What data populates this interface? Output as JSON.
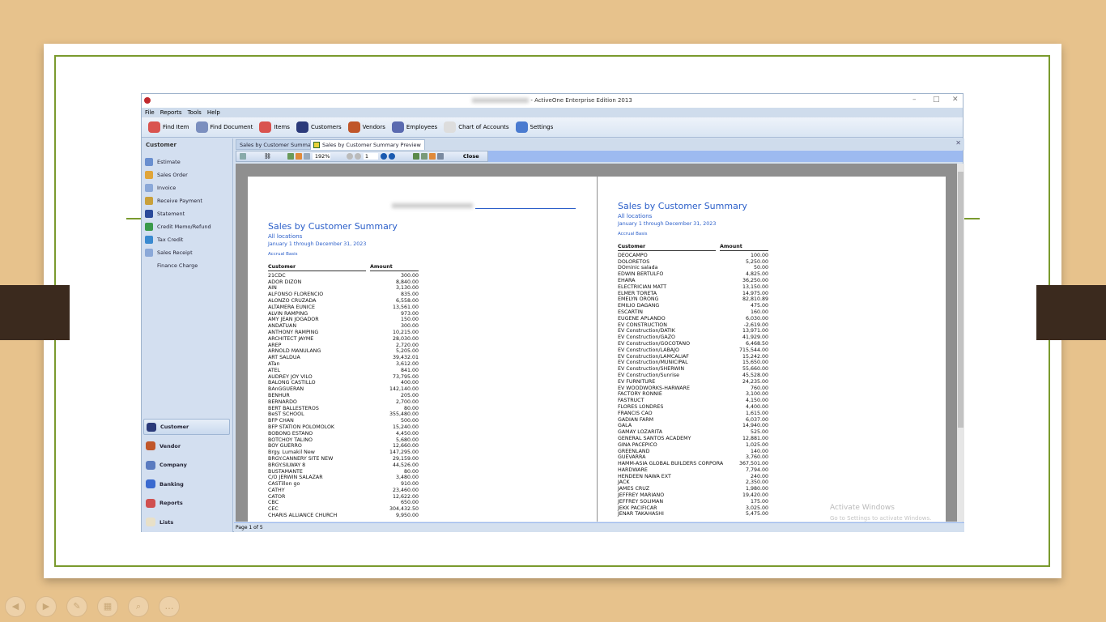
{
  "window": {
    "title": "- ActiveOne Enterprise Edition 2013"
  },
  "menu": [
    "File",
    "Reports",
    "Tools",
    "Help"
  ],
  "toolbar": [
    {
      "label": "Find Item",
      "icon": "find-item-icon",
      "color": "#d9534f"
    },
    {
      "label": "Find Document",
      "icon": "find-document-icon",
      "color": "#7b8fbf"
    },
    {
      "label": "Items",
      "icon": "items-icon",
      "color": "#d9534f"
    },
    {
      "label": "Customers",
      "icon": "customers-icon",
      "color": "#2b3a7a"
    },
    {
      "label": "Vendors",
      "icon": "vendors-icon",
      "color": "#c0562a"
    },
    {
      "label": "Employees",
      "icon": "employees-icon",
      "color": "#5a6ab0"
    },
    {
      "label": "Chart of Accounts",
      "icon": "chart-of-accounts-icon",
      "color": "#dddddd"
    },
    {
      "label": "Settings",
      "icon": "settings-icon",
      "color": "#4a7bd0"
    }
  ],
  "sidebar": {
    "header": "Customer",
    "items": [
      {
        "label": "Estimate",
        "icon": "estimate-icon",
        "color": "#6a8fcf"
      },
      {
        "label": "Sales Order",
        "icon": "sales-order-icon",
        "color": "#e0a53a"
      },
      {
        "label": "Invoice",
        "icon": "invoice-icon",
        "color": "#8aa8d8"
      },
      {
        "label": "Receive Payment",
        "icon": "receive-payment-icon",
        "color": "#c9a03a"
      },
      {
        "label": "Statement",
        "icon": "statement-icon",
        "color": "#2a4a9a"
      },
      {
        "label": "Credit Memo/Refund",
        "icon": "credit-memo-icon",
        "color": "#3a9a4a"
      },
      {
        "label": "Tax Credit",
        "icon": "tax-credit-icon",
        "color": "#3a8ad0"
      },
      {
        "label": "Sales Receipt",
        "icon": "sales-receipt-icon",
        "color": "#8aa8d8"
      },
      {
        "label": "Finance Charge",
        "icon": "",
        "color": ""
      }
    ],
    "nav": [
      {
        "label": "Customer",
        "icon": "customer-icon",
        "color": "#2b3a7a",
        "selected": true
      },
      {
        "label": "Vendor",
        "icon": "vendor-icon",
        "color": "#c0562a"
      },
      {
        "label": "Company",
        "icon": "company-icon",
        "color": "#5a7bc0"
      },
      {
        "label": "Banking",
        "icon": "banking-icon",
        "color": "#3a6ad0"
      },
      {
        "label": "Reports",
        "icon": "reports-icon",
        "color": "#d05050"
      },
      {
        "label": "Lists",
        "icon": "lists-icon",
        "color": "#e8e0c8"
      }
    ]
  },
  "tabs": [
    {
      "label": "Sales by Customer Summary",
      "active": false
    },
    {
      "label": "Sales by Customer Summary Preview",
      "active": true
    }
  ],
  "preview_toolbar": {
    "zoom": "192%",
    "page": "1",
    "close": "Close"
  },
  "status": "Page 1 of 5",
  "report": {
    "title": "Sales by Customer Summary",
    "locations": "All locations",
    "period": "January 1 through December 31, 2023",
    "basis": "Accrual Basis",
    "col_customer": "Customer",
    "col_amount": "Amount"
  },
  "left_page_rows": [
    [
      "21CDC",
      "300.00"
    ],
    [
      "ADOR DIZON",
      "8,840.00"
    ],
    [
      "AIN",
      "3,130.00"
    ],
    [
      "ALFONSO FLORENCIO",
      "835.00"
    ],
    [
      "ALONZO CRUZADA",
      "6,558.00"
    ],
    [
      "ALTAMERA EUNICE",
      "13,561.00"
    ],
    [
      "ALVIN RAMPING",
      "973.00"
    ],
    [
      "AMY JEAN JOGADOR",
      "150.00"
    ],
    [
      "ANDATUAN",
      "300.00"
    ],
    [
      "ANTHONY RAMPING",
      "10,215.00"
    ],
    [
      "ARCHITECT JAYME",
      "28,030.00"
    ],
    [
      "AREP",
      "2,720.00"
    ],
    [
      "ARNOLD MANULANG",
      "5,205.00"
    ],
    [
      "ART SALDUA",
      "39,432.01"
    ],
    [
      "ATan",
      "3,612.00"
    ],
    [
      "ATEL",
      "841.00"
    ],
    [
      "AUDREY JOY VILO",
      "73,795.00"
    ],
    [
      "BALONG CASTILLO",
      "400.00"
    ],
    [
      "BAnGGUERAN",
      "142,140.00"
    ],
    [
      "BENHUR",
      "205.00"
    ],
    [
      "BERNARDO",
      "2,700.00"
    ],
    [
      "BERT BALLESTEROS",
      "80.00"
    ],
    [
      "BeST SCHOOL",
      "355,480.00"
    ],
    [
      "BFP CHAN",
      "500.00"
    ],
    [
      "BFP STATION POLOMOLOK",
      "15,240.00"
    ],
    [
      "BOBONG ESTANO",
      "4,450.00"
    ],
    [
      "BOTCHOY TALINO",
      "5,680.00"
    ],
    [
      "BOY GUERRO",
      "12,660.00"
    ],
    [
      "Brgy. Lumakil New",
      "147,295.00"
    ],
    [
      "BRGY.CANNERY SITE NEW",
      "29,159.00"
    ],
    [
      "BRGY.SILWAY 8",
      "44,526.00"
    ],
    [
      "BUSTAMANTE",
      "80.00"
    ],
    [
      "C/O JERWIN SALAZAR",
      "3,480.00"
    ],
    [
      "CASTillon go",
      "910.00"
    ],
    [
      "CATHY",
      "23,460.00"
    ],
    [
      "CATOR",
      "12,622.00"
    ],
    [
      "CBC",
      "650.00"
    ],
    [
      "CEC",
      "304,432.50"
    ],
    [
      "CHARIS ALLIANCE CHURCH",
      "9,950.00"
    ]
  ],
  "right_page_rows": [
    [
      "DEOCAMPO",
      "100.00"
    ],
    [
      "DOLORETOS",
      "5,250.00"
    ],
    [
      "DOminic salada",
      "50.00"
    ],
    [
      "EDWIN BERTULFO",
      "4,825.00"
    ],
    [
      "EHARA",
      "36,250.00"
    ],
    [
      "ELECTRICIAN MATT",
      "13,150.00"
    ],
    [
      "ELMER TORETA",
      "14,975.00"
    ],
    [
      "EMELYN ORONG",
      "82,810.89"
    ],
    [
      "EMILIO DAGANG",
      "475.00"
    ],
    [
      "ESCARTIN",
      "160.00"
    ],
    [
      "EUGENE APLANDO",
      "6,030.00"
    ],
    [
      "EV CONSTRUCTION",
      "-2,619.00"
    ],
    [
      "EV Construction/DATIK",
      "13,971.00"
    ],
    [
      "EV Construction/GAZO",
      "41,929.00"
    ],
    [
      "EV Construction/GOCOTANO",
      "6,468.50"
    ],
    [
      "EV Construction/LABAJO",
      "715,544.00"
    ],
    [
      "EV Construction/LAMCALIAF",
      "15,242.00"
    ],
    [
      "EV Construction/MUNICIPAL",
      "15,650.00"
    ],
    [
      "EV Construction/SHERWIN",
      "55,660.00"
    ],
    [
      "EV Construction/Sunrise",
      "45,528.00"
    ],
    [
      "EV FURNITURE",
      "24,235.00"
    ],
    [
      "EV WOODWORKS-HARWARE",
      "760.00"
    ],
    [
      "FACTORY RONNIE",
      "3,100.00"
    ],
    [
      "FASTRUCT",
      "4,150.00"
    ],
    [
      "FLORES LONDRES",
      "4,400.00"
    ],
    [
      "FRANCIS CAO",
      "1,615.00"
    ],
    [
      "GADIAN FARM",
      "6,037.00"
    ],
    [
      "GALA",
      "14,940.00"
    ],
    [
      "GAMAY LOZARITA",
      "525.00"
    ],
    [
      "GENERAL SANTOS ACADEMY",
      "12,881.00"
    ],
    [
      "GINA PACEPICO",
      "1,025.00"
    ],
    [
      "GREENLAND",
      "140.00"
    ],
    [
      "GUEVARRA",
      "3,760.00"
    ],
    [
      "HAMM-ASIA GLOBAL BUILDERS CORPORA",
      "367,501.00"
    ],
    [
      "HARDWARE",
      "7,794.00"
    ],
    [
      "HENDEEN NAWA EXT",
      "240.00"
    ],
    [
      "JACK",
      "2,350.00"
    ],
    [
      "JAMES CRUZ",
      "1,980.00"
    ],
    [
      "JEFFREY MARIANO",
      "19,420.00"
    ],
    [
      "JEFFREY SOLIMAN",
      "175.00"
    ],
    [
      "JEKK PACIFICAR",
      "3,025.00"
    ],
    [
      "JENAR TAKAHASHI",
      "5,475.00"
    ]
  ],
  "watermark": {
    "line1": "Activate Windows",
    "line2": "Go to Settings to activate Windows."
  },
  "presentation_controls": [
    {
      "icon": "previous-icon",
      "glyph": "◀"
    },
    {
      "icon": "next-icon",
      "glyph": "▶"
    },
    {
      "icon": "pen-icon",
      "glyph": "✎"
    },
    {
      "icon": "slides-grid-icon",
      "glyph": "▦"
    },
    {
      "icon": "zoom-icon",
      "glyph": "⌕"
    },
    {
      "icon": "more-icon",
      "glyph": "…"
    }
  ]
}
